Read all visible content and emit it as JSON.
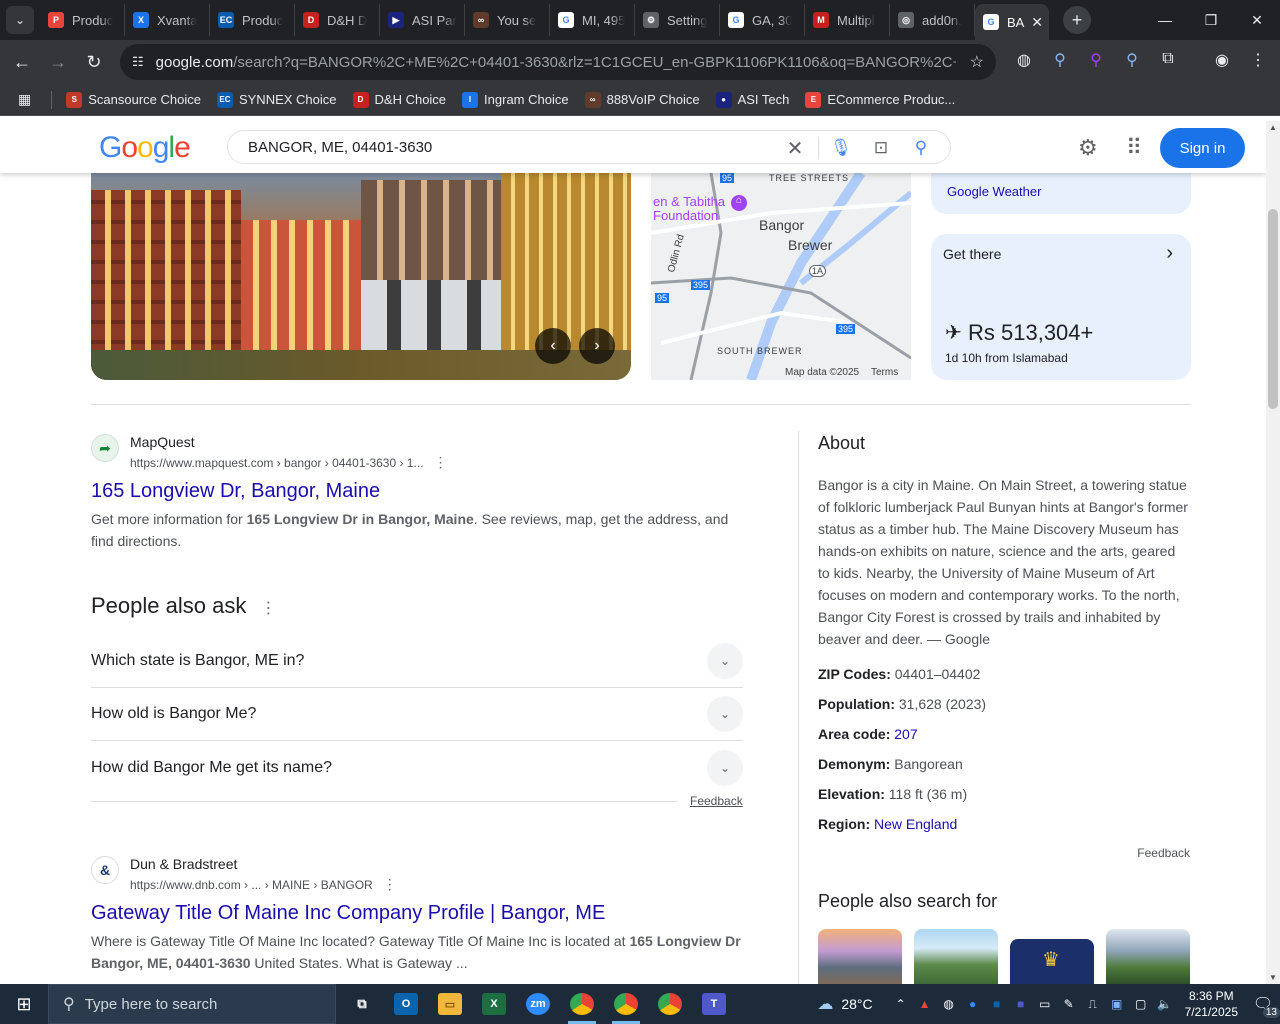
{
  "browser": {
    "tabs": [
      {
        "title": "Produc",
        "color": "#e8453c",
        "glyph": "P"
      },
      {
        "title": "Xvanta",
        "color": "#1a73e8",
        "glyph": "X"
      },
      {
        "title": "Produc",
        "color": "#0b5cad",
        "glyph": "EC"
      },
      {
        "title": "D&H D",
        "color": "#c5221f",
        "glyph": "D"
      },
      {
        "title": "ASI Par",
        "color": "#1a237e",
        "glyph": "▶"
      },
      {
        "title": "You se",
        "color": "#5f3b2e",
        "glyph": "∞"
      },
      {
        "title": "MI, 495",
        "color": "#ffffff",
        "glyph": "G"
      },
      {
        "title": "Setting",
        "color": "#5f6368",
        "glyph": "⚙"
      },
      {
        "title": "GA, 30",
        "color": "#ffffff",
        "glyph": "G"
      },
      {
        "title": "Multipl",
        "color": "#c5221f",
        "glyph": "M"
      },
      {
        "title": "add0n.",
        "color": "#5f6368",
        "glyph": "◎"
      }
    ],
    "active_tab": {
      "title": "BA",
      "glyph": "G"
    },
    "url_host": "google.com",
    "url_rest": "/search?q=BANGOR%2C+ME%2C+04401-3630&rlz=1C1GCEU_en-GBPK1106PK1106&oq=BANGOR%2C+ME%2C+...",
    "bookmarks": [
      {
        "label": "Scansource Choice",
        "color": "#c0392b",
        "glyph": "S"
      },
      {
        "label": "SYNNEX Choice",
        "color": "#0b5cad",
        "glyph": "EC"
      },
      {
        "label": "D&H Choice",
        "color": "#c5221f",
        "glyph": "D"
      },
      {
        "label": "Ingram Choice",
        "color": "#1a73e8",
        "glyph": "I"
      },
      {
        "label": "888VoIP Choice",
        "color": "#5f3b2e",
        "glyph": "∞"
      },
      {
        "label": "ASI Tech",
        "color": "#1a237e",
        "glyph": "●"
      },
      {
        "label": "ECommerce Produc...",
        "color": "#e8453c",
        "glyph": "E"
      }
    ]
  },
  "google": {
    "query": "BANGOR, ME, 04401-3630",
    "signin": "Sign in",
    "weather_link": "Google Weather",
    "get_there": {
      "title": "Get there",
      "price": "Rs 513,304+",
      "detail": "1d 10h from Islamabad"
    },
    "map": {
      "labels": [
        "TREE STREETS",
        "en & Tabitha",
        "Foundation",
        "Bangor",
        "Brewer",
        "Odlin Rd",
        "SOUTH BREWER",
        "Map data ©2025",
        "Terms"
      ],
      "shields": [
        "95",
        "1A",
        "395",
        "95",
        "395"
      ]
    },
    "results": [
      {
        "site": "MapQuest",
        "url": "https://www.mapquest.com › bangor › 04401-3630 › 1...",
        "title": "165 Longview Dr, Bangor, Maine",
        "snippet_pre": "Get more information for ",
        "snippet_bold": "165 Longview Dr in Bangor, Maine",
        "snippet_post": ". See reviews, map, get the address, and find directions."
      },
      {
        "site": "Dun & Bradstreet",
        "url": "https://www.dnb.com › ... › MAINE › BANGOR",
        "title": "Gateway Title Of Maine Inc Company Profile | Bangor, ME",
        "snippet_pre": "Where is Gateway Title Of Maine Inc located? Gateway Title Of Maine Inc is located at ",
        "snippet_bold": "165 Longview Dr Bangor, ME, 04401-3630",
        "snippet_post": " United States. What is Gateway ..."
      }
    ],
    "paa": {
      "title": "People also ask",
      "questions": [
        "Which state is Bangor, ME in?",
        "How old is Bangor Me?",
        "How did Bangor Me get its name?"
      ],
      "feedback": "Feedback"
    },
    "about": {
      "title": "About",
      "description": "Bangor is a city in Maine. On Main Street, a towering statue of folkloric lumberjack Paul Bunyan hints at Bangor's former status as a timber hub. The Maine Discovery Museum has hands-on exhibits on nature, science and the arts, geared to kids. Nearby, the University of Maine Museum of Art focuses on modern and contemporary works. To the north, Bangor City Forest is crossed by trails and inhabited by beaver and deer. — Google",
      "facts": [
        {
          "label": "ZIP Codes:",
          "value": "04401–04402",
          "link": false
        },
        {
          "label": "Population:",
          "value": "31,628 (2023)",
          "link": false
        },
        {
          "label": "Area code:",
          "value": "207",
          "link": true
        },
        {
          "label": "Demonym:",
          "value": "Bangorean",
          "link": false
        },
        {
          "label": "Elevation:",
          "value": "118 ft (36 m)",
          "link": false
        },
        {
          "label": "Region:",
          "value": "New England",
          "link": true
        }
      ],
      "feedback": "Feedback"
    },
    "people_also_search": "People also search for"
  },
  "taskbar": {
    "search_placeholder": "Type here to search",
    "weather": "28°C",
    "time": "8:36 PM",
    "date": "7/21/2025",
    "notifications": "13"
  },
  "colors": {
    "accent": "#1a73e8",
    "link": "#1a0dab",
    "chrome_dark": "#202124"
  }
}
